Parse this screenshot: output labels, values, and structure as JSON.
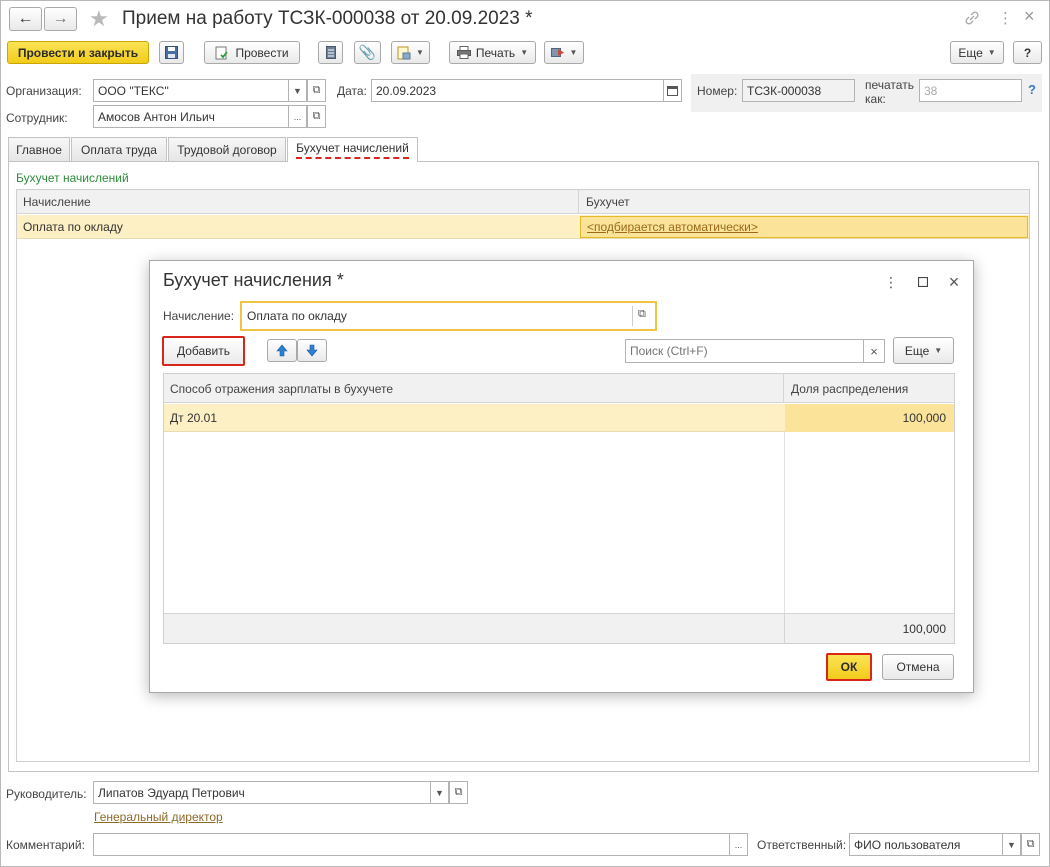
{
  "window": {
    "title": "Прием на работу ТСЗК-000038 от 20.09.2023 *"
  },
  "toolbar": {
    "post_close": "Провести и закрыть",
    "post": "Провести",
    "print": "Печать",
    "more": "Еще",
    "help": "?"
  },
  "form": {
    "org_label": "Организация:",
    "org_value": "ООО \"ТЕКС\"",
    "date_label": "Дата:",
    "date_value": "20.09.2023",
    "number_label": "Номер:",
    "number_value": "ТСЗК-000038",
    "print_as_label_1": "печатать",
    "print_as_label_2": "как:",
    "print_as_value": "38",
    "print_as_help": "?",
    "employee_label": "Сотрудник:",
    "employee_value": "Амосов Антон Ильич"
  },
  "tabs": [
    {
      "label": "Главное"
    },
    {
      "label": "Оплата труда"
    },
    {
      "label": "Трудовой договор"
    },
    {
      "label": "Бухучет начислений"
    }
  ],
  "accounting": {
    "section_title": "Бухучет начислений",
    "columns": [
      "Начисление",
      "Бухучет"
    ],
    "rows": [
      {
        "accrual": "Оплата по окладу",
        "accounting": "<подбирается автоматически>"
      }
    ]
  },
  "dialog": {
    "title": "Бухучет начисления *",
    "accrual_label": "Начисление:",
    "accrual_value": "Оплата по окладу",
    "add_button": "Добавить",
    "search_placeholder": "Поиск (Ctrl+F)",
    "clear": "×",
    "more": "Еще",
    "columns": [
      "Способ отражения зарплаты в бухучете",
      "Доля распределения"
    ],
    "rows": [
      {
        "method": "Дт 20.01",
        "share": "100,000"
      }
    ],
    "total_share": "100,000",
    "ok": "ОК",
    "cancel": "Отмена"
  },
  "footer": {
    "manager_label": "Руководитель:",
    "manager_value": "Липатов Эдуард Петрович",
    "manager_position": "Генеральный директор",
    "comment_label": "Комментарий:",
    "comment_value": "",
    "responsible_label": "Ответственный:",
    "responsible_value": "ФИО пользователя"
  },
  "colors": {
    "primary_button": "#f2cc1a",
    "selected_row": "#fdf0c4",
    "active_cell": "#fbe39a",
    "highlight_red": "#d9261c",
    "section_green": "#2e8b3a"
  }
}
